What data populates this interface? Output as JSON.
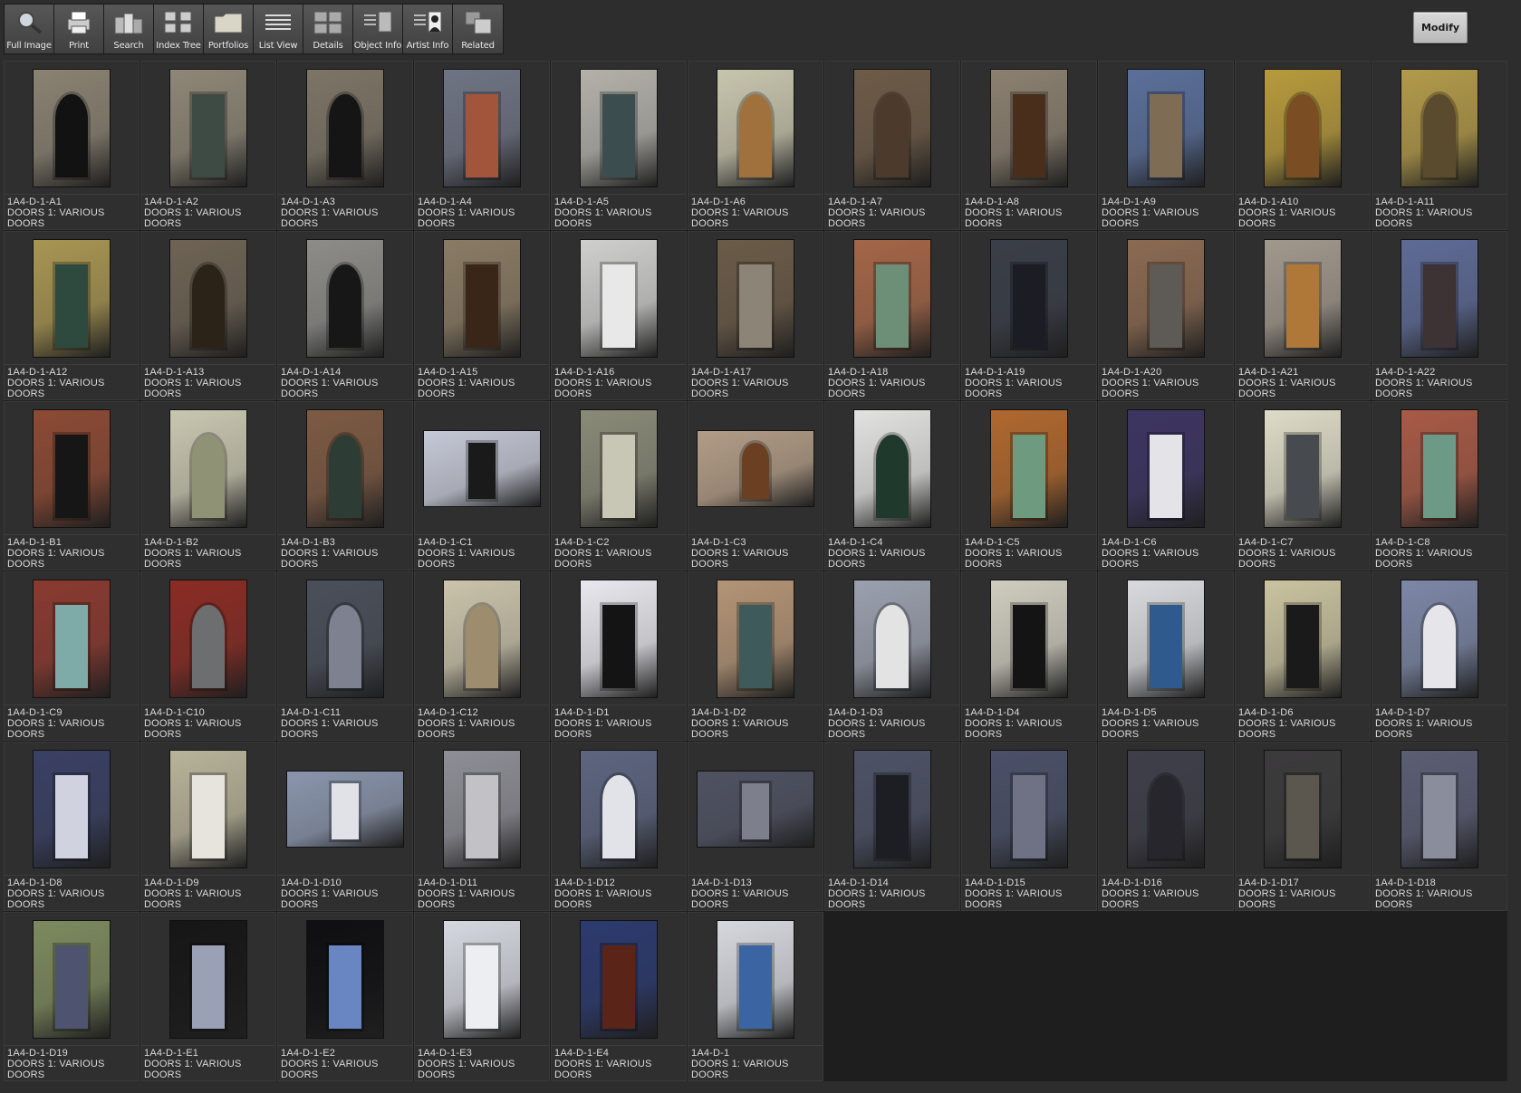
{
  "toolbar": {
    "buttons": [
      {
        "label": "Full Image",
        "icon": "magnifier-icon"
      },
      {
        "label": "Print",
        "icon": "printer-icon"
      },
      {
        "label": "Search",
        "icon": "search-icon"
      },
      {
        "label": "Index Tree",
        "icon": "index-tree-icon"
      },
      {
        "label": "Portfolios",
        "icon": "folder-icon"
      },
      {
        "label": "List View",
        "icon": "list-view-icon"
      },
      {
        "label": "Details",
        "icon": "details-icon"
      },
      {
        "label": "Object Info",
        "icon": "object-info-icon"
      },
      {
        "label": "Artist  Info",
        "icon": "artist-info-icon"
      },
      {
        "label": "Related",
        "icon": "related-icon"
      }
    ],
    "modify_label": "Modify"
  },
  "colors": {
    "background": "#2d2d2d",
    "cell": "#2f2f2f",
    "caption_text": "#dadada"
  },
  "thumbnails": [
    {
      "id": "1A4-D-1-A1",
      "title": "DOORS 1: VARIOUS",
      "category": "DOORS",
      "orientation": "portrait",
      "wall": "#8a8272",
      "door": "#121212",
      "arched": true
    },
    {
      "id": "1A4-D-1-A2",
      "title": "DOORS 1: VARIOUS",
      "category": "DOORS",
      "orientation": "portrait",
      "wall": "#8e8777",
      "door": "#3e4a44",
      "arched": false
    },
    {
      "id": "1A4-D-1-A3",
      "title": "DOORS 1: VARIOUS",
      "category": "DOORS",
      "orientation": "portrait",
      "wall": "#7d7566",
      "door": "#151515",
      "arched": true
    },
    {
      "id": "1A4-D-1-A4",
      "title": "DOORS 1: VARIOUS",
      "category": "DOORS",
      "orientation": "portrait",
      "wall": "#6f7484",
      "door": "#a2553a",
      "arched": false
    },
    {
      "id": "1A4-D-1-A5",
      "title": "DOORS 1: VARIOUS",
      "category": "DOORS",
      "orientation": "portrait",
      "wall": "#b3b1aa",
      "door": "#3b4d4f",
      "arched": false
    },
    {
      "id": "1A4-D-1-A6",
      "title": "DOORS 1: VARIOUS",
      "category": "DOORS",
      "orientation": "portrait",
      "wall": "#c7c5ad",
      "door": "#a0713c",
      "arched": true
    },
    {
      "id": "1A4-D-1-A7",
      "title": "DOORS 1: VARIOUS",
      "category": "DOORS",
      "orientation": "portrait",
      "wall": "#6e5b48",
      "door": "#4c3a2c",
      "arched": true
    },
    {
      "id": "1A4-D-1-A8",
      "title": "DOORS 1: VARIOUS",
      "category": "DOORS",
      "orientation": "portrait",
      "wall": "#8b8070",
      "door": "#4a2e1c",
      "arched": false
    },
    {
      "id": "1A4-D-1-A9",
      "title": "DOORS 1: VARIOUS",
      "category": "DOORS",
      "orientation": "portrait",
      "wall": "#5a6f9a",
      "door": "#7f6c55",
      "arched": false
    },
    {
      "id": "1A4-D-1-A10",
      "title": "DOORS 1: VARIOUS",
      "category": "DOORS",
      "orientation": "portrait",
      "wall": "#b79a3c",
      "door": "#7a4e22",
      "arched": true
    },
    {
      "id": "1A4-D-1-A11",
      "title": "DOORS 1: VARIOUS",
      "category": "DOORS",
      "orientation": "portrait",
      "wall": "#b29a4a",
      "door": "#5a4a2e",
      "arched": true
    },
    {
      "id": "1A4-D-1-A12",
      "title": "DOORS 1: VARIOUS",
      "category": "DOORS",
      "orientation": "portrait",
      "wall": "#a79552",
      "door": "#2e4a3e",
      "arched": false
    },
    {
      "id": "1A4-D-1-A13",
      "title": "DOORS 1: VARIOUS",
      "category": "DOORS",
      "orientation": "portrait",
      "wall": "#6e6354",
      "door": "#2b2218",
      "arched": true
    },
    {
      "id": "1A4-D-1-A14",
      "title": "DOORS 1: VARIOUS",
      "category": "DOORS",
      "orientation": "portrait",
      "wall": "#8d8c88",
      "door": "#171717",
      "arched": true
    },
    {
      "id": "1A4-D-1-A15",
      "title": "DOORS 1: VARIOUS",
      "category": "DOORS",
      "orientation": "portrait",
      "wall": "#8a7b64",
      "door": "#3a2618",
      "arched": false
    },
    {
      "id": "1A4-D-1-A16",
      "title": "DOORS 1: VARIOUS",
      "category": "DOORS",
      "orientation": "portrait",
      "wall": "#cfcfcd",
      "door": "#e8e8e8",
      "arched": false
    },
    {
      "id": "1A4-D-1-A17",
      "title": "DOORS 1: VARIOUS",
      "category": "DOORS",
      "orientation": "portrait",
      "wall": "#6b5b48",
      "door": "#8c8476",
      "arched": false
    },
    {
      "id": "1A4-D-1-A18",
      "title": "DOORS 1: VARIOUS",
      "category": "DOORS",
      "orientation": "portrait",
      "wall": "#a46648",
      "door": "#6d8e77",
      "arched": false
    },
    {
      "id": "1A4-D-1-A19",
      "title": "DOORS 1: VARIOUS",
      "category": "DOORS",
      "orientation": "portrait",
      "wall": "#3a3e48",
      "door": "#1b1c24",
      "arched": false
    },
    {
      "id": "1A4-D-1-A20",
      "title": "DOORS 1: VARIOUS",
      "category": "DOORS",
      "orientation": "portrait",
      "wall": "#8b6a52",
      "door": "#5e5a55",
      "arched": false
    },
    {
      "id": "1A4-D-1-A21",
      "title": "DOORS 1: VARIOUS",
      "category": "DOORS",
      "orientation": "portrait",
      "wall": "#a1988d",
      "door": "#b07838",
      "arched": false
    },
    {
      "id": "1A4-D-1-A22",
      "title": "DOORS 1: VARIOUS",
      "category": "DOORS",
      "orientation": "portrait",
      "wall": "#5e6b96",
      "door": "#3d3234",
      "arched": false
    },
    {
      "id": "1A4-D-1-B1",
      "title": "DOORS 1: VARIOUS",
      "category": "DOORS",
      "orientation": "portrait",
      "wall": "#8c4a34",
      "door": "#161616",
      "arched": false
    },
    {
      "id": "1A4-D-1-B2",
      "title": "DOORS 1: VARIOUS",
      "category": "DOORS",
      "orientation": "portrait",
      "wall": "#c9c6b0",
      "door": "#8f9275",
      "arched": true
    },
    {
      "id": "1A4-D-1-B3",
      "title": "DOORS 1: VARIOUS",
      "category": "DOORS",
      "orientation": "portrait",
      "wall": "#7d5a43",
      "door": "#2d3d36",
      "arched": true
    },
    {
      "id": "1A4-D-1-C1",
      "title": "DOORS 1: VARIOUS",
      "category": "DOORS",
      "orientation": "landscape",
      "wall": "#c5c8d6",
      "door": "#1a1a1a",
      "arched": false
    },
    {
      "id": "1A4-D-1-C2",
      "title": "DOORS 1: VARIOUS",
      "category": "DOORS",
      "orientation": "portrait",
      "wall": "#8a8a78",
      "door": "#c8c6b4",
      "arched": false
    },
    {
      "id": "1A4-D-1-C3",
      "title": "DOORS 1: VARIOUS",
      "category": "DOORS",
      "orientation": "landscape",
      "wall": "#b29c86",
      "door": "#6a3f22",
      "arched": true
    },
    {
      "id": "1A4-D-1-C4",
      "title": "DOORS 1: VARIOUS",
      "category": "DOORS",
      "orientation": "portrait",
      "wall": "#e2e2e0",
      "door": "#1f3a2c",
      "arched": true
    },
    {
      "id": "1A4-D-1-C5",
      "title": "DOORS 1: VARIOUS",
      "category": "DOORS",
      "orientation": "portrait",
      "wall": "#b0682e",
      "door": "#6e9a80",
      "arched": false
    },
    {
      "id": "1A4-D-1-C6",
      "title": "DOORS 1: VARIOUS",
      "category": "DOORS",
      "orientation": "portrait",
      "wall": "#3d3562",
      "door": "#e3e3e8",
      "arched": false
    },
    {
      "id": "1A4-D-1-C7",
      "title": "DOORS 1: VARIOUS",
      "category": "DOORS",
      "orientation": "portrait",
      "wall": "#dedbc7",
      "door": "#474a4e",
      "arched": false
    },
    {
      "id": "1A4-D-1-C8",
      "title": "DOORS 1: VARIOUS",
      "category": "DOORS",
      "orientation": "portrait",
      "wall": "#a85a46",
      "door": "#6c9a86",
      "arched": false
    },
    {
      "id": "1A4-D-1-C9",
      "title": "DOORS 1: VARIOUS",
      "category": "DOORS",
      "orientation": "portrait",
      "wall": "#8a3a30",
      "door": "#7eaaa8",
      "arched": false
    },
    {
      "id": "1A4-D-1-C10",
      "title": "DOORS 1: VARIOUS",
      "category": "DOORS",
      "orientation": "portrait",
      "wall": "#8a2c24",
      "door": "#6d6e70",
      "arched": true
    },
    {
      "id": "1A4-D-1-C11",
      "title": "DOORS 1: VARIOUS",
      "category": "DOORS",
      "orientation": "portrait",
      "wall": "#4a4f5a",
      "door": "#7d8190",
      "arched": true
    },
    {
      "id": "1A4-D-1-C12",
      "title": "DOORS 1: VARIOUS",
      "category": "DOORS",
      "orientation": "portrait",
      "wall": "#cbc3ab",
      "door": "#9e8c6e",
      "arched": true
    },
    {
      "id": "1A4-D-1-D1",
      "title": "DOORS 1: VARIOUS",
      "category": "DOORS",
      "orientation": "portrait",
      "wall": "#e8e8ee",
      "door": "#141414",
      "arched": false
    },
    {
      "id": "1A4-D-1-D2",
      "title": "DOORS 1: VARIOUS",
      "category": "DOORS",
      "orientation": "portrait",
      "wall": "#b39476",
      "door": "#3e5a5a",
      "arched": false
    },
    {
      "id": "1A4-D-1-D3",
      "title": "DOORS 1: VARIOUS",
      "category": "DOORS",
      "orientation": "portrait",
      "wall": "#9ba0ae",
      "door": "#e3e3e3",
      "arched": true
    },
    {
      "id": "1A4-D-1-D4",
      "title": "DOORS 1: VARIOUS",
      "category": "DOORS",
      "orientation": "portrait",
      "wall": "#cfcdbf",
      "door": "#141414",
      "arched": false
    },
    {
      "id": "1A4-D-1-D5",
      "title": "DOORS 1: VARIOUS",
      "category": "DOORS",
      "orientation": "portrait",
      "wall": "#d8dade",
      "door": "#2e5a8e",
      "arched": false
    },
    {
      "id": "1A4-D-1-D6",
      "title": "DOORS 1: VARIOUS",
      "category": "DOORS",
      "orientation": "portrait",
      "wall": "#c9c3a0",
      "door": "#1a1a1a",
      "arched": false
    },
    {
      "id": "1A4-D-1-D7",
      "title": "DOORS 1: VARIOUS",
      "category": "DOORS",
      "orientation": "portrait",
      "wall": "#7c87a6",
      "door": "#e6e6ea",
      "arched": true
    },
    {
      "id": "1A4-D-1-D8",
      "title": "DOORS 1: VARIOUS",
      "category": "DOORS",
      "orientation": "portrait",
      "wall": "#3a4064",
      "door": "#d0d2e0",
      "arched": false
    },
    {
      "id": "1A4-D-1-D9",
      "title": "DOORS 1: VARIOUS",
      "category": "DOORS",
      "orientation": "portrait",
      "wall": "#b8b39a",
      "door": "#e6e4dc",
      "arched": false
    },
    {
      "id": "1A4-D-1-D10",
      "title": "DOORS 1: VARIOUS",
      "category": "DOORS",
      "orientation": "landscape",
      "wall": "#8a95ac",
      "door": "#e0e2e8",
      "arched": false
    },
    {
      "id": "1A4-D-1-D11",
      "title": "DOORS 1: VARIOUS",
      "category": "DOORS",
      "orientation": "portrait",
      "wall": "#8e8e96",
      "door": "#c2c2c6",
      "arched": false
    },
    {
      "id": "1A4-D-1-D12",
      "title": "DOORS 1: VARIOUS",
      "category": "DOORS",
      "orientation": "portrait",
      "wall": "#5d6580",
      "door": "#e1e3e8",
      "arched": true
    },
    {
      "id": "1A4-D-1-D13",
      "title": "DOORS 1: VARIOUS",
      "category": "DOORS",
      "orientation": "landscape",
      "wall": "#4f5262",
      "door": "#7d7f8c",
      "arched": false
    },
    {
      "id": "1A4-D-1-D14",
      "title": "DOORS 1: VARIOUS",
      "category": "DOORS",
      "orientation": "portrait",
      "wall": "#4d5266",
      "door": "#1c1e24",
      "arched": false
    },
    {
      "id": "1A4-D-1-D15",
      "title": "DOORS 1: VARIOUS",
      "category": "DOORS",
      "orientation": "portrait",
      "wall": "#4a5068",
      "door": "#6e7284",
      "arched": false
    },
    {
      "id": "1A4-D-1-D16",
      "title": "DOORS 1: VARIOUS",
      "category": "DOORS",
      "orientation": "portrait",
      "wall": "#3f3f4a",
      "door": "#26262c",
      "arched": true
    },
    {
      "id": "1A4-D-1-D17",
      "title": "DOORS 1: VARIOUS",
      "category": "DOORS",
      "orientation": "portrait",
      "wall": "#3c3b3c",
      "door": "#5c574e",
      "arched": false
    },
    {
      "id": "1A4-D-1-D18",
      "title": "DOORS 1: VARIOUS",
      "category": "DOORS",
      "orientation": "portrait",
      "wall": "#5b5e74",
      "door": "#8a8d9c",
      "arched": false
    },
    {
      "id": "1A4-D-1-D19",
      "title": "DOORS 1: VARIOUS",
      "category": "DOORS",
      "orientation": "portrait",
      "wall": "#7d8a5e",
      "door": "#4e5470",
      "arched": false
    },
    {
      "id": "1A4-D-1-E1",
      "title": "DOORS 1: VARIOUS",
      "category": "DOORS",
      "orientation": "portrait",
      "wall": "#161616",
      "door": "#9aa0b6",
      "arched": false
    },
    {
      "id": "1A4-D-1-E2",
      "title": "DOORS 1: VARIOUS",
      "category": "DOORS",
      "orientation": "portrait",
      "wall": "#0f0f12",
      "door": "#6a86c2",
      "arched": false
    },
    {
      "id": "1A4-D-1-E3",
      "title": "DOORS 1: VARIOUS",
      "category": "DOORS",
      "orientation": "portrait",
      "wall": "#d5d8e0",
      "door": "#eceef2",
      "arched": false
    },
    {
      "id": "1A4-D-1-E4",
      "title": "DOORS 1: VARIOUS",
      "category": "DOORS",
      "orientation": "portrait",
      "wall": "#2c3a6e",
      "door": "#5a2418",
      "arched": false
    },
    {
      "id": "1A4-D-1",
      "title": "DOORS 1: VARIOUS",
      "category": "DOORS",
      "orientation": "portrait",
      "wall": "#d6d8de",
      "door": "#3a64a2",
      "arched": false
    }
  ]
}
